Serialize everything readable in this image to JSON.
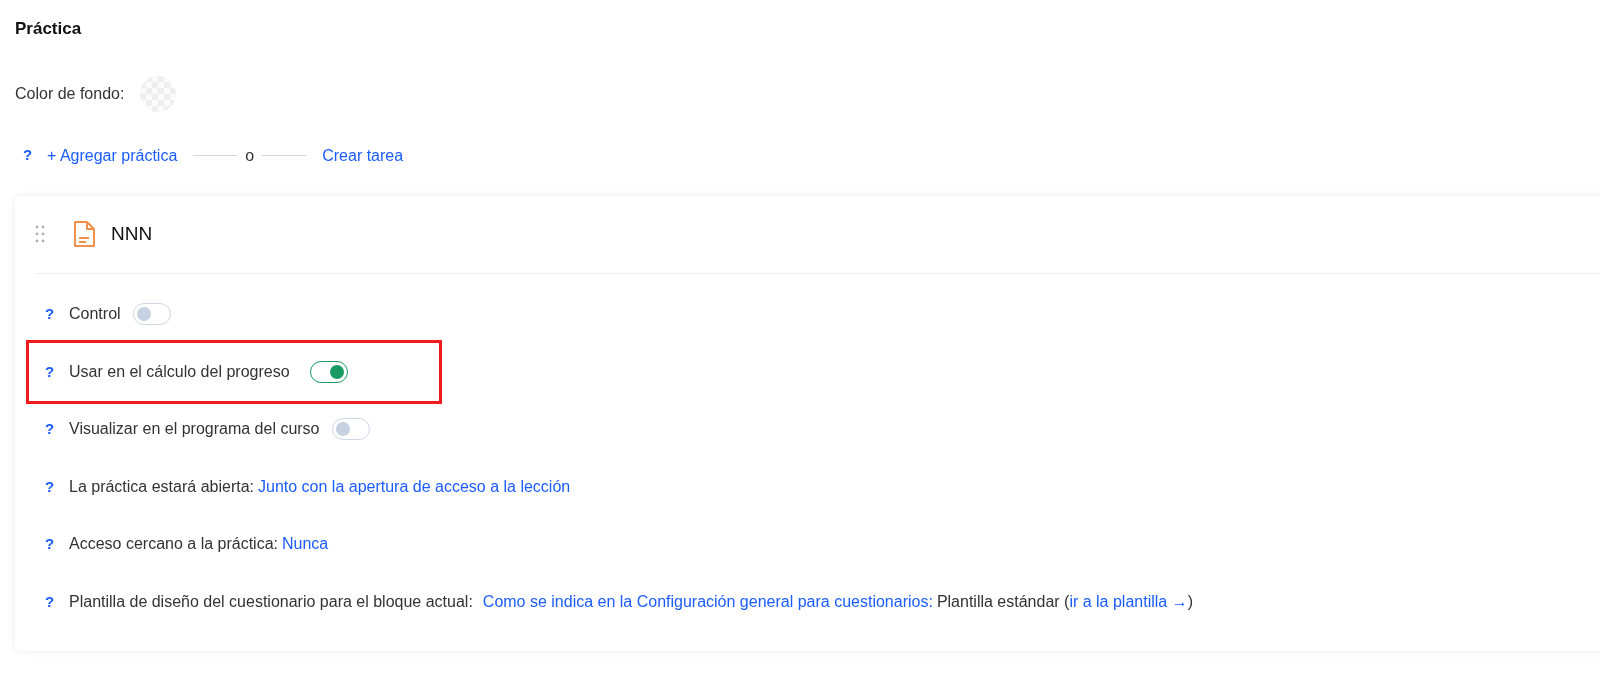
{
  "title": "Práctica",
  "background_color": {
    "label": "Color de fondo:"
  },
  "actions": {
    "help": "?",
    "add": "+ Agregar práctica",
    "separator": "o",
    "create": "Crear tarea"
  },
  "card": {
    "name": "NNN",
    "settings": [
      {
        "kind": "toggle",
        "help": "?",
        "label": "Control",
        "on": false,
        "highlighted": false
      },
      {
        "kind": "toggle",
        "help": "?",
        "label": "Usar en el cálculo del progreso",
        "on": true,
        "highlighted": true
      },
      {
        "kind": "toggle",
        "help": "?",
        "label": "Visualizar en el programa del curso",
        "on": false,
        "highlighted": false
      },
      {
        "kind": "value",
        "help": "?",
        "label": "La práctica estará abierta:",
        "segments": [
          {
            "kind": "link",
            "text": "Junto con la apertura de acceso a la lección"
          }
        ]
      },
      {
        "kind": "value",
        "help": "?",
        "label": "Acceso cercano a la práctica:",
        "segments": [
          {
            "kind": "link",
            "text": "Nunca"
          }
        ]
      },
      {
        "kind": "value",
        "help": "?",
        "label": "Plantilla de diseño del cuestionario para el bloque actual:",
        "segments": [
          {
            "kind": "link",
            "text": "Como se indica en la Configuración general para cuestionarios:"
          },
          {
            "kind": "text",
            "text": "Plantilla estándar ("
          },
          {
            "kind": "link",
            "text": "ir a la plantilla →"
          },
          {
            "kind": "text",
            "text": ")"
          }
        ]
      }
    ]
  }
}
